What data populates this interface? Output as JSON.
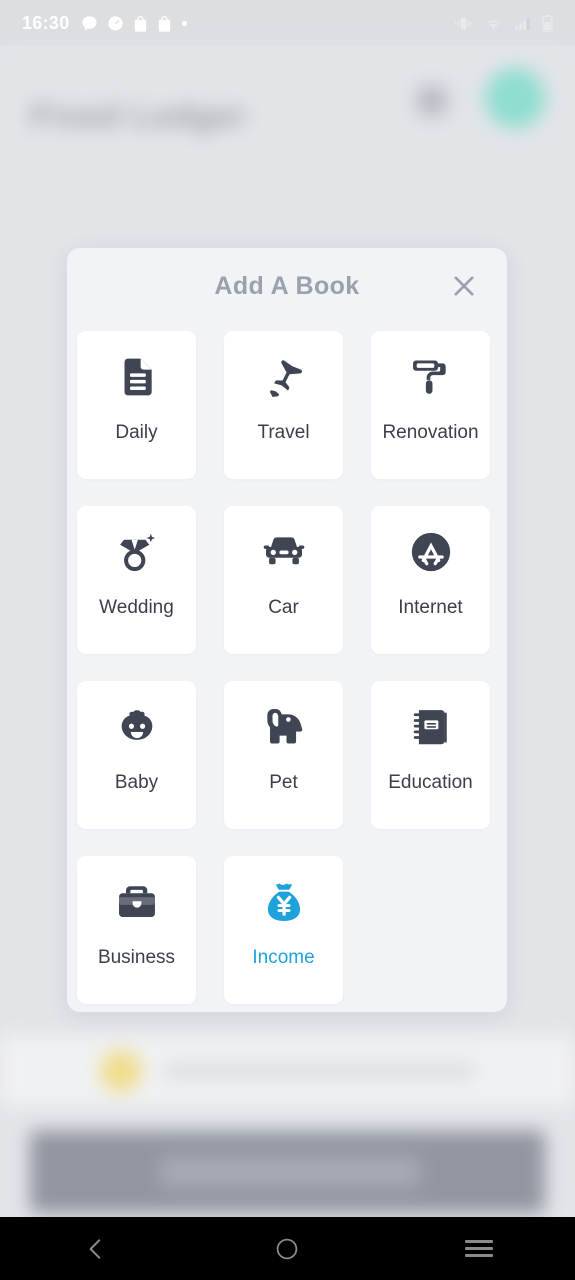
{
  "status_bar": {
    "time": "16:30",
    "left_icons": [
      "message-bubble-icon",
      "timer-icon",
      "shopping-bag-icon",
      "shopping-bag-icon",
      "dot-icon"
    ],
    "right_icons": [
      "vibrate-icon",
      "wifi-icon",
      "signal-bars-icon",
      "battery-icon"
    ],
    "background": "#dcdee2",
    "foreground": "#ffffff"
  },
  "background_app": {
    "title": "Fixed Ledger",
    "header_icon": "search-icon",
    "avatar": "user-avatar",
    "avatar_color": "#8fded0",
    "list_icon_color": "#f0dd8c",
    "banner": "ad-banner"
  },
  "modal": {
    "title": "Add A Book",
    "close_icon": "close-icon",
    "title_color": "#9aa2ae",
    "background": "#f1f3f7",
    "card_background": "#ffffff",
    "icon_color": "#3f4553",
    "accent_color": "#1fa2dc",
    "books": [
      {
        "label": "Daily",
        "icon": "document-icon",
        "selected": false
      },
      {
        "label": "Travel",
        "icon": "airplane-icon",
        "selected": false
      },
      {
        "label": "Renovation",
        "icon": "paint-roller-icon",
        "selected": false
      },
      {
        "label": "Wedding",
        "icon": "diamond-ring-icon",
        "selected": false
      },
      {
        "label": "Car",
        "icon": "car-icon",
        "selected": false
      },
      {
        "label": "Internet",
        "icon": "app-store-icon",
        "selected": false
      },
      {
        "label": "Baby",
        "icon": "baby-face-icon",
        "selected": false
      },
      {
        "label": "Pet",
        "icon": "dog-icon",
        "selected": false
      },
      {
        "label": "Education",
        "icon": "notebook-icon",
        "selected": false
      },
      {
        "label": "Business",
        "icon": "briefcase-icon",
        "selected": false
      },
      {
        "label": "Income",
        "icon": "money-bag-yen-icon",
        "selected": true
      }
    ]
  },
  "nav_bar": {
    "background": "#000000",
    "items": [
      {
        "name": "back-button",
        "icon": "chevron-left-icon"
      },
      {
        "name": "home-button",
        "icon": "circle-icon"
      },
      {
        "name": "recents-button",
        "icon": "hamburger-icon"
      }
    ]
  }
}
